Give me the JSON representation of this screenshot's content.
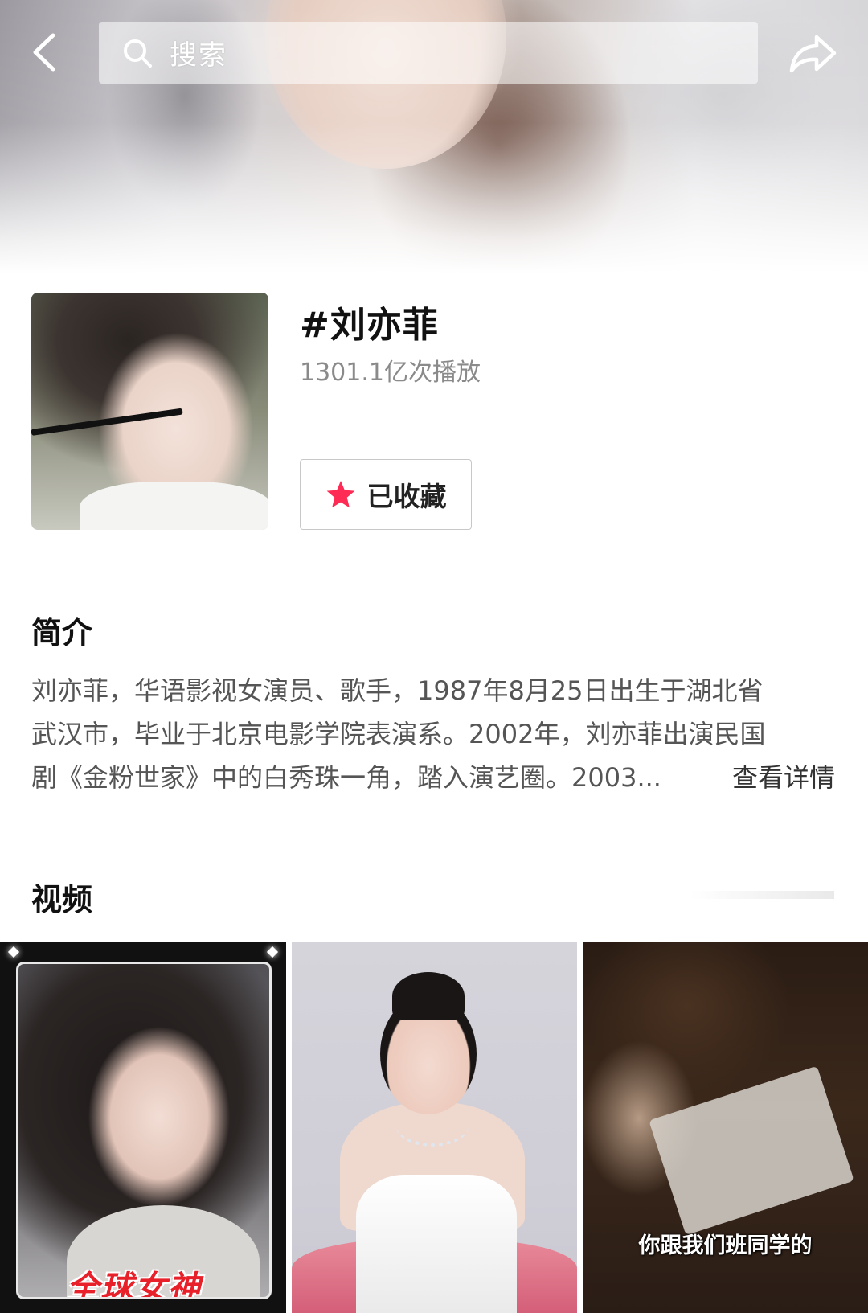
{
  "header": {
    "search_placeholder": "搜索",
    "back_icon": "chevron-left-icon",
    "search_icon": "search-icon",
    "share_icon": "share-arrow-icon"
  },
  "topic": {
    "title": "#刘亦菲",
    "play_count": "1301.1亿次播放",
    "collect_label": "已收藏",
    "collect_icon": "star-icon",
    "accent_color": "#fe2c55"
  },
  "intro": {
    "title": "简介",
    "lines": [
      "刘亦菲，华语影视女演员、歌手，1987年8月25日出生于湖北省",
      "武汉市，毕业于北京电影学院表演系。2002年，刘亦菲出演民国",
      "剧《金粉世家》中的白秀珠一角，踏入演艺圈。2003..."
    ],
    "more_label": "查看详情"
  },
  "videos": {
    "title": "视频",
    "items": [
      {
        "caption": "全球女神"
      },
      {
        "caption": ""
      },
      {
        "caption": "你跟我们班同学的"
      }
    ]
  }
}
